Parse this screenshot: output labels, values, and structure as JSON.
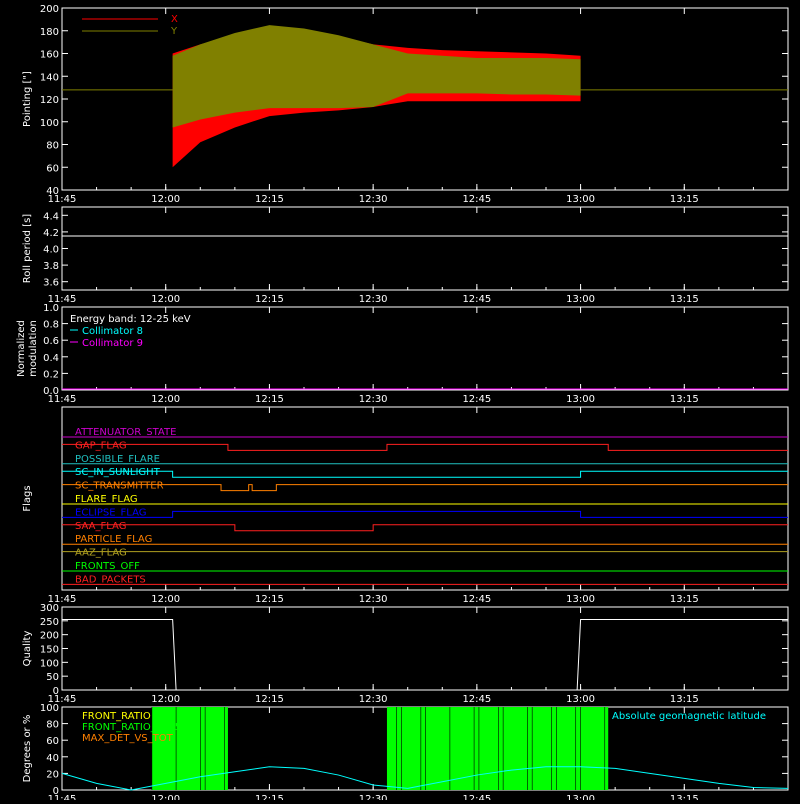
{
  "x_ticks": [
    "11:45",
    "12:00",
    "12:15",
    "12:30",
    "12:45",
    "13:00",
    "13:15"
  ],
  "colors": {
    "x_series": "#ff0000",
    "y_series": "#808000",
    "white": "#ffffff",
    "cyan": "#00ffff",
    "magenta": "#ff00ff",
    "green": "#00ff00",
    "orange": "#ff8000",
    "yellow": "#ffff00",
    "blue": "#0000ff",
    "red": "#ff2020",
    "purple": "#cc00cc",
    "olive": "#b0a020"
  },
  "chart_data": [
    {
      "id": "pointing",
      "type": "area",
      "ylabel": "Pointing [\"]",
      "ylim": [
        40,
        200
      ],
      "y_ticks": [
        40,
        60,
        80,
        100,
        120,
        140,
        160,
        180,
        200
      ],
      "legend": [
        {
          "label": "X",
          "color": "#ff0000"
        },
        {
          "label": "Y",
          "color": "#808000"
        }
      ],
      "baseline_value": 128,
      "active_range": [
        "12:01",
        "13:00"
      ],
      "x_envelope": {
        "times": [
          "12:01",
          "12:05",
          "12:10",
          "12:15",
          "12:20",
          "12:25",
          "12:30",
          "12:35",
          "12:40",
          "12:45",
          "12:50",
          "12:55",
          "13:00"
        ],
        "upper": [
          160,
          168,
          176,
          182,
          180,
          175,
          168,
          165,
          163,
          162,
          161,
          160,
          158
        ],
        "lower": [
          60,
          82,
          95,
          105,
          108,
          110,
          113,
          118,
          118,
          118,
          118,
          118,
          118
        ]
      },
      "y_envelope": {
        "times": [
          "12:01",
          "12:05",
          "12:10",
          "12:15",
          "12:20",
          "12:25",
          "12:30",
          "12:35",
          "12:40",
          "12:45",
          "12:50",
          "12:55",
          "13:00"
        ],
        "upper": [
          158,
          168,
          178,
          185,
          182,
          176,
          168,
          160,
          158,
          156,
          156,
          156,
          155
        ],
        "lower": [
          95,
          102,
          108,
          112,
          112,
          112,
          113,
          125,
          125,
          125,
          124,
          124,
          123
        ]
      }
    },
    {
      "id": "roll",
      "type": "line",
      "ylabel": "Roll period [s]",
      "ylim": [
        3.5,
        4.5
      ],
      "y_ticks": [
        3.6,
        3.8,
        4.0,
        4.2,
        4.4
      ],
      "value": 4.15
    },
    {
      "id": "modulation",
      "type": "line",
      "ylabel": "Normalized modulation",
      "ylim": [
        0,
        1
      ],
      "y_ticks": [
        0.0,
        0.2,
        0.4,
        0.6,
        0.8,
        1.0
      ],
      "annotations": [
        {
          "text": "Energy band: 12-25 keV",
          "color": "#ffffff"
        },
        {
          "text": "Collimator 8",
          "color": "#00ffff"
        },
        {
          "text": "Collimator 9",
          "color": "#ff00ff"
        }
      ],
      "value": 0
    },
    {
      "id": "flags",
      "type": "line",
      "ylabel": "Flags",
      "flags": [
        {
          "name": "ATTENUATOR_STATE",
          "color": "#cc00cc",
          "segments": [
            [
              "11:45",
              "13:30",
              0
            ]
          ]
        },
        {
          "name": "GAP_FLAG",
          "color": "#ff2020",
          "segments": [
            [
              "11:45",
              "12:09",
              1
            ],
            [
              "12:09",
              "12:32",
              0
            ],
            [
              "12:32",
              "13:04",
              1
            ],
            [
              "13:04",
              "13:30",
              0
            ]
          ]
        },
        {
          "name": "POSSIBLE_FLARE",
          "color": "#20c0c0",
          "segments": [
            [
              "11:45",
              "13:30",
              0
            ]
          ]
        },
        {
          "name": "SC_IN_SUNLIGHT",
          "color": "#00ffff",
          "segments": [
            [
              "11:45",
              "12:01",
              1
            ],
            [
              "12:01",
              "13:00",
              0
            ],
            [
              "13:00",
              "13:30",
              1
            ]
          ]
        },
        {
          "name": "SC_TRANSMITTER",
          "color": "#ff8000",
          "segments": [
            [
              "11:45",
              "12:08",
              1
            ],
            [
              "12:08",
              "12:12",
              0
            ],
            [
              "12:12",
              "12:12.5",
              1
            ],
            [
              "12:12.5",
              "12:16",
              0
            ],
            [
              "12:16",
              "13:30",
              1
            ]
          ]
        },
        {
          "name": "FLARE_FLAG",
          "color": "#ffff00",
          "segments": [
            [
              "11:45",
              "13:30",
              0
            ]
          ]
        },
        {
          "name": "ECLIPSE_FLAG",
          "color": "#0000ff",
          "segments": [
            [
              "11:45",
              "12:01",
              0
            ],
            [
              "12:01",
              "13:00",
              1
            ],
            [
              "13:00",
              "13:30",
              0
            ]
          ]
        },
        {
          "name": "SAA_FLAG",
          "color": "#ff2020",
          "segments": [
            [
              "11:45",
              "12:10",
              1
            ],
            [
              "12:10",
              "12:30",
              0
            ],
            [
              "12:30",
              "13:30",
              1
            ]
          ]
        },
        {
          "name": "PARTICLE_FLAG",
          "color": "#ff8000",
          "segments": [
            [
              "11:45",
              "13:30",
              0
            ]
          ]
        },
        {
          "name": "AAZ_FLAG",
          "color": "#b0a020",
          "segments": [
            [
              "11:45",
              "13:30",
              1
            ]
          ]
        },
        {
          "name": "FRONTS_OFF",
          "color": "#00ff00",
          "segments": [
            [
              "11:45",
              "13:30",
              0
            ]
          ]
        },
        {
          "name": "BAD_PACKETS",
          "color": "#ff2020",
          "segments": [
            [
              "11:45",
              "13:30",
              0
            ]
          ]
        }
      ]
    },
    {
      "id": "quality",
      "type": "line",
      "ylabel": "Quality",
      "ylim": [
        0,
        300
      ],
      "y_ticks": [
        0,
        50,
        100,
        150,
        200,
        250,
        300
      ],
      "points": [
        [
          "11:45",
          255
        ],
        [
          "12:01",
          255
        ],
        [
          "12:01.5",
          0
        ],
        [
          "12:59.5",
          0
        ],
        [
          "13:00",
          255
        ],
        [
          "13:30",
          255
        ]
      ]
    },
    {
      "id": "geomag",
      "type": "line",
      "ylabel": "Degrees or %",
      "ylim": [
        0,
        100
      ],
      "y_ticks": [
        0,
        20,
        40,
        60,
        80,
        100
      ],
      "legend": [
        {
          "label": "FRONT_RATIO",
          "color": "#ffff00"
        },
        {
          "label": "FRONT_RATIO_1225",
          "color": "#00ff00"
        },
        {
          "label": "MAX_DET_VS_TOT",
          "color": "#ff8000"
        }
      ],
      "annotation": {
        "text": "Absolute geomagnetic latitude",
        "color": "#00ffff"
      },
      "front_ratio_blocks": [
        [
          "11:58",
          "12:09",
          100
        ],
        [
          "12:32",
          "13:04",
          100
        ]
      ],
      "latitude_points": [
        [
          "11:45",
          20
        ],
        [
          "11:50",
          8
        ],
        [
          "11:55",
          0
        ],
        [
          "12:00",
          8
        ],
        [
          "12:05",
          16
        ],
        [
          "12:10",
          22
        ],
        [
          "12:15",
          28
        ],
        [
          "12:20",
          26
        ],
        [
          "12:25",
          18
        ],
        [
          "12:30",
          6
        ],
        [
          "12:35",
          2
        ],
        [
          "12:40",
          10
        ],
        [
          "12:45",
          18
        ],
        [
          "12:50",
          24
        ],
        [
          "12:55",
          28
        ],
        [
          "13:00",
          28
        ],
        [
          "13:05",
          26
        ],
        [
          "13:10",
          20
        ],
        [
          "13:15",
          14
        ],
        [
          "13:20",
          8
        ],
        [
          "13:25",
          3
        ],
        [
          "13:30",
          2
        ]
      ]
    }
  ]
}
